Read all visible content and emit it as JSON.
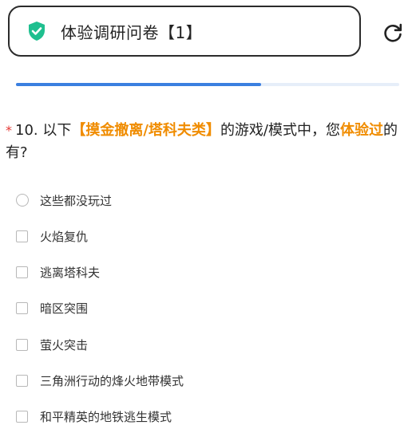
{
  "header": {
    "title": "体验调研问卷【1】",
    "shield_icon": "shield-check-icon",
    "reload_icon": "reload-icon",
    "accent_color": "#1fbf8f"
  },
  "progress": {
    "fraction": 0.64,
    "fill_color": "#3b7fe0"
  },
  "question": {
    "required_mark": "*",
    "part1": "10. 以下",
    "highlight1": "【摸金撤离/塔科夫类】",
    "part2": "的游戏/模式中，您",
    "highlight2": "体验过",
    "part3": "的有?"
  },
  "options": [
    {
      "label": "这些都没玩过",
      "type": "radio"
    },
    {
      "label": "火焰复仇",
      "type": "checkbox"
    },
    {
      "label": "逃离塔科夫",
      "type": "checkbox"
    },
    {
      "label": "暗区突围",
      "type": "checkbox"
    },
    {
      "label": "萤火突击",
      "type": "checkbox"
    },
    {
      "label": "三角洲行动的烽火地带模式",
      "type": "checkbox"
    },
    {
      "label": "和平精英的地铁逃生模式",
      "type": "checkbox"
    }
  ]
}
